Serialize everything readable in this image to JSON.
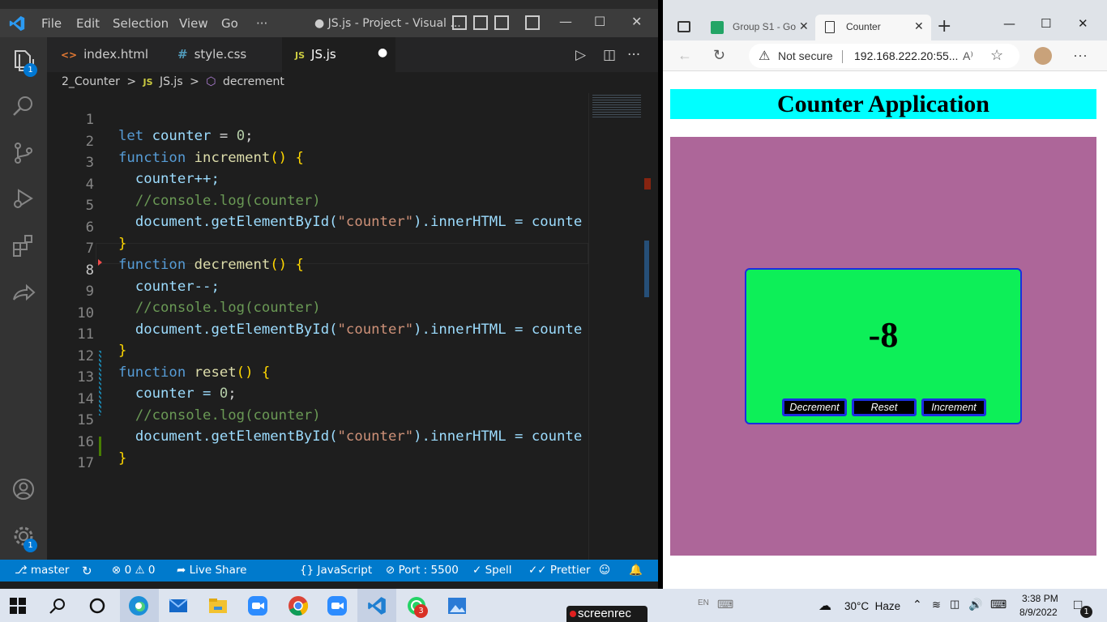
{
  "vscode": {
    "menu": [
      "File",
      "Edit",
      "Selection",
      "View",
      "Go",
      "···"
    ],
    "title": "● JS.js - Project - Visual ...",
    "tabs": [
      {
        "icon": "<>",
        "label": "index.html"
      },
      {
        "icon": "#",
        "label": "style.css"
      },
      {
        "icon": "JS",
        "label": "JS.js",
        "dirty": "●"
      }
    ],
    "breadcrumb": [
      "2_Counter",
      ">",
      "JS",
      "JS.js",
      ">",
      "decrement"
    ],
    "activity_badges": {
      "explorer": "1",
      "settings": "1"
    },
    "code_lines": [
      {
        "n": "1"
      },
      {
        "n": "2"
      },
      {
        "n": "3"
      },
      {
        "n": "4"
      },
      {
        "n": "5"
      },
      {
        "n": "6"
      },
      {
        "n": "7"
      },
      {
        "n": "8"
      },
      {
        "n": "9"
      },
      {
        "n": "10"
      },
      {
        "n": "11"
      },
      {
        "n": "12"
      },
      {
        "n": "13"
      },
      {
        "n": "14"
      },
      {
        "n": "15"
      },
      {
        "n": "16"
      },
      {
        "n": "17"
      }
    ],
    "code_text": {
      "let": "let",
      "counter": "counter",
      "eq0": " = ",
      "zero": "0",
      "semi": ";",
      "function": "function",
      "increment": "increment",
      "decrement": "decrement",
      "reset": "reset",
      "parens": "()",
      "open_brace": "{",
      "close_brace": "}",
      "counter_inc": "counter++;",
      "counter_dec": "counter--;",
      "comment": "//console.log(counter)",
      "doc": "document.getElementById(",
      "doc_str": "\"counter\"",
      "doc_tail": ").innerHTML = counte",
      "counter_reset_a": "counter = ",
      "counter_reset_b": ";"
    },
    "status": {
      "branch": "master",
      "errors": "0",
      "warnings": "0",
      "live_share": "Live Share",
      "language": "JavaScript",
      "port": "Port : 5500",
      "spell": "Spell",
      "prettier": "Prettier"
    }
  },
  "edge": {
    "tabs": [
      {
        "label": "Group S1 - Go"
      },
      {
        "label": "Counter"
      }
    ],
    "not_secure": "Not secure",
    "url": "192.168.222.20:55...",
    "read_aloud": "A⁾"
  },
  "app": {
    "title": "Counter Application",
    "counter_value": "-8",
    "buttons": {
      "decrement": "Decrement",
      "reset": "Reset",
      "increment": "Increment"
    },
    "colors": {
      "title_bg": "#00ffff",
      "area_bg": "#ad6699",
      "card_bg": "#0def58",
      "button_border": "#1c2ee0"
    }
  },
  "taskbar": {
    "screenrec": "screenrec",
    "weather": "30°C  Haze",
    "time": "3:38 PM",
    "date": "8/9/2022",
    "whatsapp_badge": "3",
    "notification_badge": "1",
    "lang": "EN"
  }
}
